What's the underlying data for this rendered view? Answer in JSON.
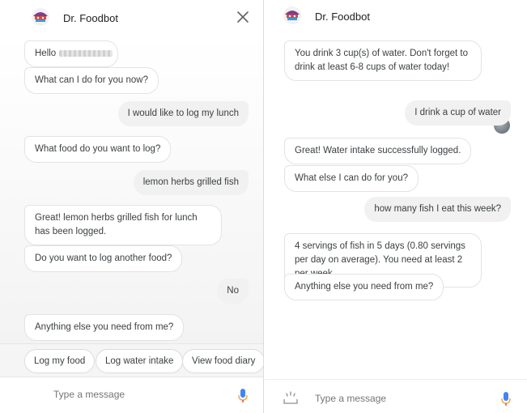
{
  "left": {
    "header": {
      "title": "Dr. Foodbot"
    },
    "messages": [
      {
        "role": "bot",
        "text": "Hello"
      },
      {
        "role": "bot",
        "text": "What can I do for you now?"
      },
      {
        "role": "user",
        "text": "I would like to log my lunch"
      },
      {
        "role": "bot",
        "text": "What food do you want to log?"
      },
      {
        "role": "user",
        "text": "lemon herbs grilled fish"
      },
      {
        "role": "bot",
        "text": "Great! lemon herbs grilled fish for lunch has been logged."
      },
      {
        "role": "bot",
        "text": "Do you want to log another food?"
      },
      {
        "role": "user",
        "text": "No"
      },
      {
        "role": "bot",
        "text": "Anything else you need from me?"
      }
    ],
    "suggestions": [
      "Log my food",
      "Log water intake",
      "View food diary"
    ],
    "input": {
      "placeholder": "Type a message"
    }
  },
  "right": {
    "header": {
      "title": "Dr. Foodbot"
    },
    "messages": [
      {
        "role": "bot",
        "text": "You drink 3 cup(s) of water. Don't forget to drink at least 6-8 cups of water today!"
      },
      {
        "role": "user",
        "text": "I drink a cup of water"
      },
      {
        "role": "bot",
        "text": "Great! Water intake successfully logged."
      },
      {
        "role": "bot",
        "text": "What else I can do for you?"
      },
      {
        "role": "user",
        "text": "how many fish I eat this week?"
      },
      {
        "role": "bot",
        "text": "4 servings of fish in 5 days  (0.80 servings per day on average). You need at least 2 per week."
      },
      {
        "role": "bot",
        "text": "Anything else you need from me?"
      }
    ],
    "input": {
      "placeholder": "Type a message"
    }
  },
  "colors": {
    "mic_blue": "#4285f4",
    "mic_orange": "#f4a340",
    "bubble_border": "#e3e3e3",
    "user_bubble": "#f1f1f1"
  },
  "icons": [
    "bot-logo-icon",
    "close-icon",
    "microphone-icon",
    "keyboard-icon",
    "user-avatar-icon"
  ]
}
